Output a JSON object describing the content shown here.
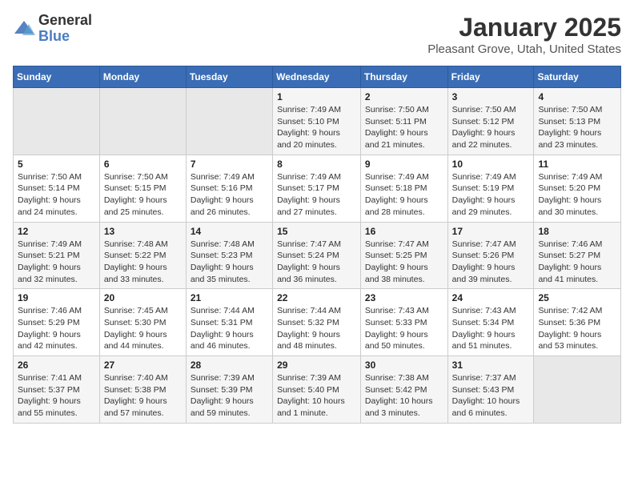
{
  "header": {
    "logo_general": "General",
    "logo_blue": "Blue",
    "month_title": "January 2025",
    "location": "Pleasant Grove, Utah, United States"
  },
  "weekdays": [
    "Sunday",
    "Monday",
    "Tuesday",
    "Wednesday",
    "Thursday",
    "Friday",
    "Saturday"
  ],
  "weeks": [
    [
      {
        "day": "",
        "info": ""
      },
      {
        "day": "",
        "info": ""
      },
      {
        "day": "",
        "info": ""
      },
      {
        "day": "1",
        "info": "Sunrise: 7:49 AM\nSunset: 5:10 PM\nDaylight: 9 hours and 20 minutes."
      },
      {
        "day": "2",
        "info": "Sunrise: 7:50 AM\nSunset: 5:11 PM\nDaylight: 9 hours and 21 minutes."
      },
      {
        "day": "3",
        "info": "Sunrise: 7:50 AM\nSunset: 5:12 PM\nDaylight: 9 hours and 22 minutes."
      },
      {
        "day": "4",
        "info": "Sunrise: 7:50 AM\nSunset: 5:13 PM\nDaylight: 9 hours and 23 minutes."
      }
    ],
    [
      {
        "day": "5",
        "info": "Sunrise: 7:50 AM\nSunset: 5:14 PM\nDaylight: 9 hours and 24 minutes."
      },
      {
        "day": "6",
        "info": "Sunrise: 7:50 AM\nSunset: 5:15 PM\nDaylight: 9 hours and 25 minutes."
      },
      {
        "day": "7",
        "info": "Sunrise: 7:49 AM\nSunset: 5:16 PM\nDaylight: 9 hours and 26 minutes."
      },
      {
        "day": "8",
        "info": "Sunrise: 7:49 AM\nSunset: 5:17 PM\nDaylight: 9 hours and 27 minutes."
      },
      {
        "day": "9",
        "info": "Sunrise: 7:49 AM\nSunset: 5:18 PM\nDaylight: 9 hours and 28 minutes."
      },
      {
        "day": "10",
        "info": "Sunrise: 7:49 AM\nSunset: 5:19 PM\nDaylight: 9 hours and 29 minutes."
      },
      {
        "day": "11",
        "info": "Sunrise: 7:49 AM\nSunset: 5:20 PM\nDaylight: 9 hours and 30 minutes."
      }
    ],
    [
      {
        "day": "12",
        "info": "Sunrise: 7:49 AM\nSunset: 5:21 PM\nDaylight: 9 hours and 32 minutes."
      },
      {
        "day": "13",
        "info": "Sunrise: 7:48 AM\nSunset: 5:22 PM\nDaylight: 9 hours and 33 minutes."
      },
      {
        "day": "14",
        "info": "Sunrise: 7:48 AM\nSunset: 5:23 PM\nDaylight: 9 hours and 35 minutes."
      },
      {
        "day": "15",
        "info": "Sunrise: 7:47 AM\nSunset: 5:24 PM\nDaylight: 9 hours and 36 minutes."
      },
      {
        "day": "16",
        "info": "Sunrise: 7:47 AM\nSunset: 5:25 PM\nDaylight: 9 hours and 38 minutes."
      },
      {
        "day": "17",
        "info": "Sunrise: 7:47 AM\nSunset: 5:26 PM\nDaylight: 9 hours and 39 minutes."
      },
      {
        "day": "18",
        "info": "Sunrise: 7:46 AM\nSunset: 5:27 PM\nDaylight: 9 hours and 41 minutes."
      }
    ],
    [
      {
        "day": "19",
        "info": "Sunrise: 7:46 AM\nSunset: 5:29 PM\nDaylight: 9 hours and 42 minutes."
      },
      {
        "day": "20",
        "info": "Sunrise: 7:45 AM\nSunset: 5:30 PM\nDaylight: 9 hours and 44 minutes."
      },
      {
        "day": "21",
        "info": "Sunrise: 7:44 AM\nSunset: 5:31 PM\nDaylight: 9 hours and 46 minutes."
      },
      {
        "day": "22",
        "info": "Sunrise: 7:44 AM\nSunset: 5:32 PM\nDaylight: 9 hours and 48 minutes."
      },
      {
        "day": "23",
        "info": "Sunrise: 7:43 AM\nSunset: 5:33 PM\nDaylight: 9 hours and 50 minutes."
      },
      {
        "day": "24",
        "info": "Sunrise: 7:43 AM\nSunset: 5:34 PM\nDaylight: 9 hours and 51 minutes."
      },
      {
        "day": "25",
        "info": "Sunrise: 7:42 AM\nSunset: 5:36 PM\nDaylight: 9 hours and 53 minutes."
      }
    ],
    [
      {
        "day": "26",
        "info": "Sunrise: 7:41 AM\nSunset: 5:37 PM\nDaylight: 9 hours and 55 minutes."
      },
      {
        "day": "27",
        "info": "Sunrise: 7:40 AM\nSunset: 5:38 PM\nDaylight: 9 hours and 57 minutes."
      },
      {
        "day": "28",
        "info": "Sunrise: 7:39 AM\nSunset: 5:39 PM\nDaylight: 9 hours and 59 minutes."
      },
      {
        "day": "29",
        "info": "Sunrise: 7:39 AM\nSunset: 5:40 PM\nDaylight: 10 hours and 1 minute."
      },
      {
        "day": "30",
        "info": "Sunrise: 7:38 AM\nSunset: 5:42 PM\nDaylight: 10 hours and 3 minutes."
      },
      {
        "day": "31",
        "info": "Sunrise: 7:37 AM\nSunset: 5:43 PM\nDaylight: 10 hours and 6 minutes."
      },
      {
        "day": "",
        "info": ""
      }
    ]
  ]
}
